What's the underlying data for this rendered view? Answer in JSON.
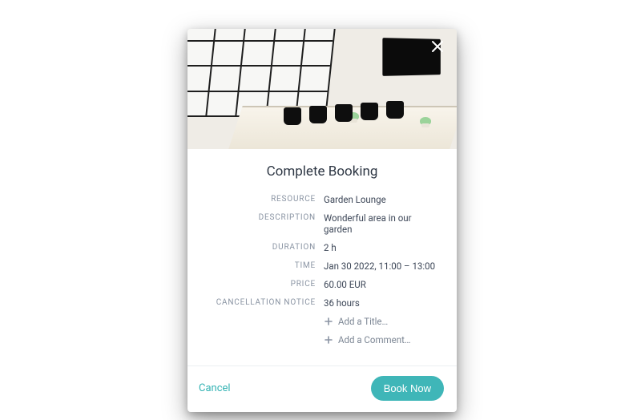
{
  "modal": {
    "title": "Complete Booking",
    "labels": {
      "resource": "RESOURCE",
      "description": "DESCRIPTION",
      "duration": "DURATION",
      "time": "TIME",
      "price": "PRICE",
      "cancellation_notice": "CANCELLATION NOTICE"
    },
    "values": {
      "resource": "Garden Lounge",
      "description": "Wonderful area in our garden",
      "duration": "2 h",
      "time": "Jan 30 2022, 11:00 – 13:00",
      "price": "60.00 EUR",
      "cancellation_notice": "36 hours"
    },
    "add_title": "Add a Title…",
    "add_comment": "Add a Comment…"
  },
  "footer": {
    "cancel": "Cancel",
    "book_now": "Book Now"
  },
  "colors": {
    "accent": "#3fb6b8"
  }
}
